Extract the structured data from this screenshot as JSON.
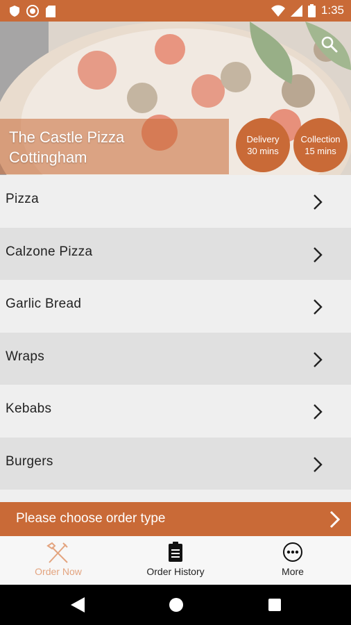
{
  "status_bar": {
    "time": "1:35"
  },
  "restaurant": {
    "name_line1": "The Castle Pizza",
    "name_line2": "Cottingham"
  },
  "badges": {
    "delivery_label": "Delivery",
    "delivery_time": "30 mins",
    "collection_label": "Collection",
    "collection_time": "15 mins"
  },
  "categories": [
    "Pizza",
    "Calzone Pizza",
    "Garlic Bread",
    "Wraps",
    "Kebabs",
    "Burgers"
  ],
  "order_type": {
    "label": "Please choose order type"
  },
  "tabs": {
    "order_now": "Order Now",
    "order_history": "Order History",
    "more": "More"
  },
  "colors": {
    "accent": "#c96a37",
    "active_tab": "#e3a47f"
  },
  "icons": {
    "search": "search-icon",
    "chevron": "chevron-right-icon",
    "order_now": "fork-knife-icon",
    "order_history": "clipboard-icon",
    "more": "more-dots-icon"
  }
}
